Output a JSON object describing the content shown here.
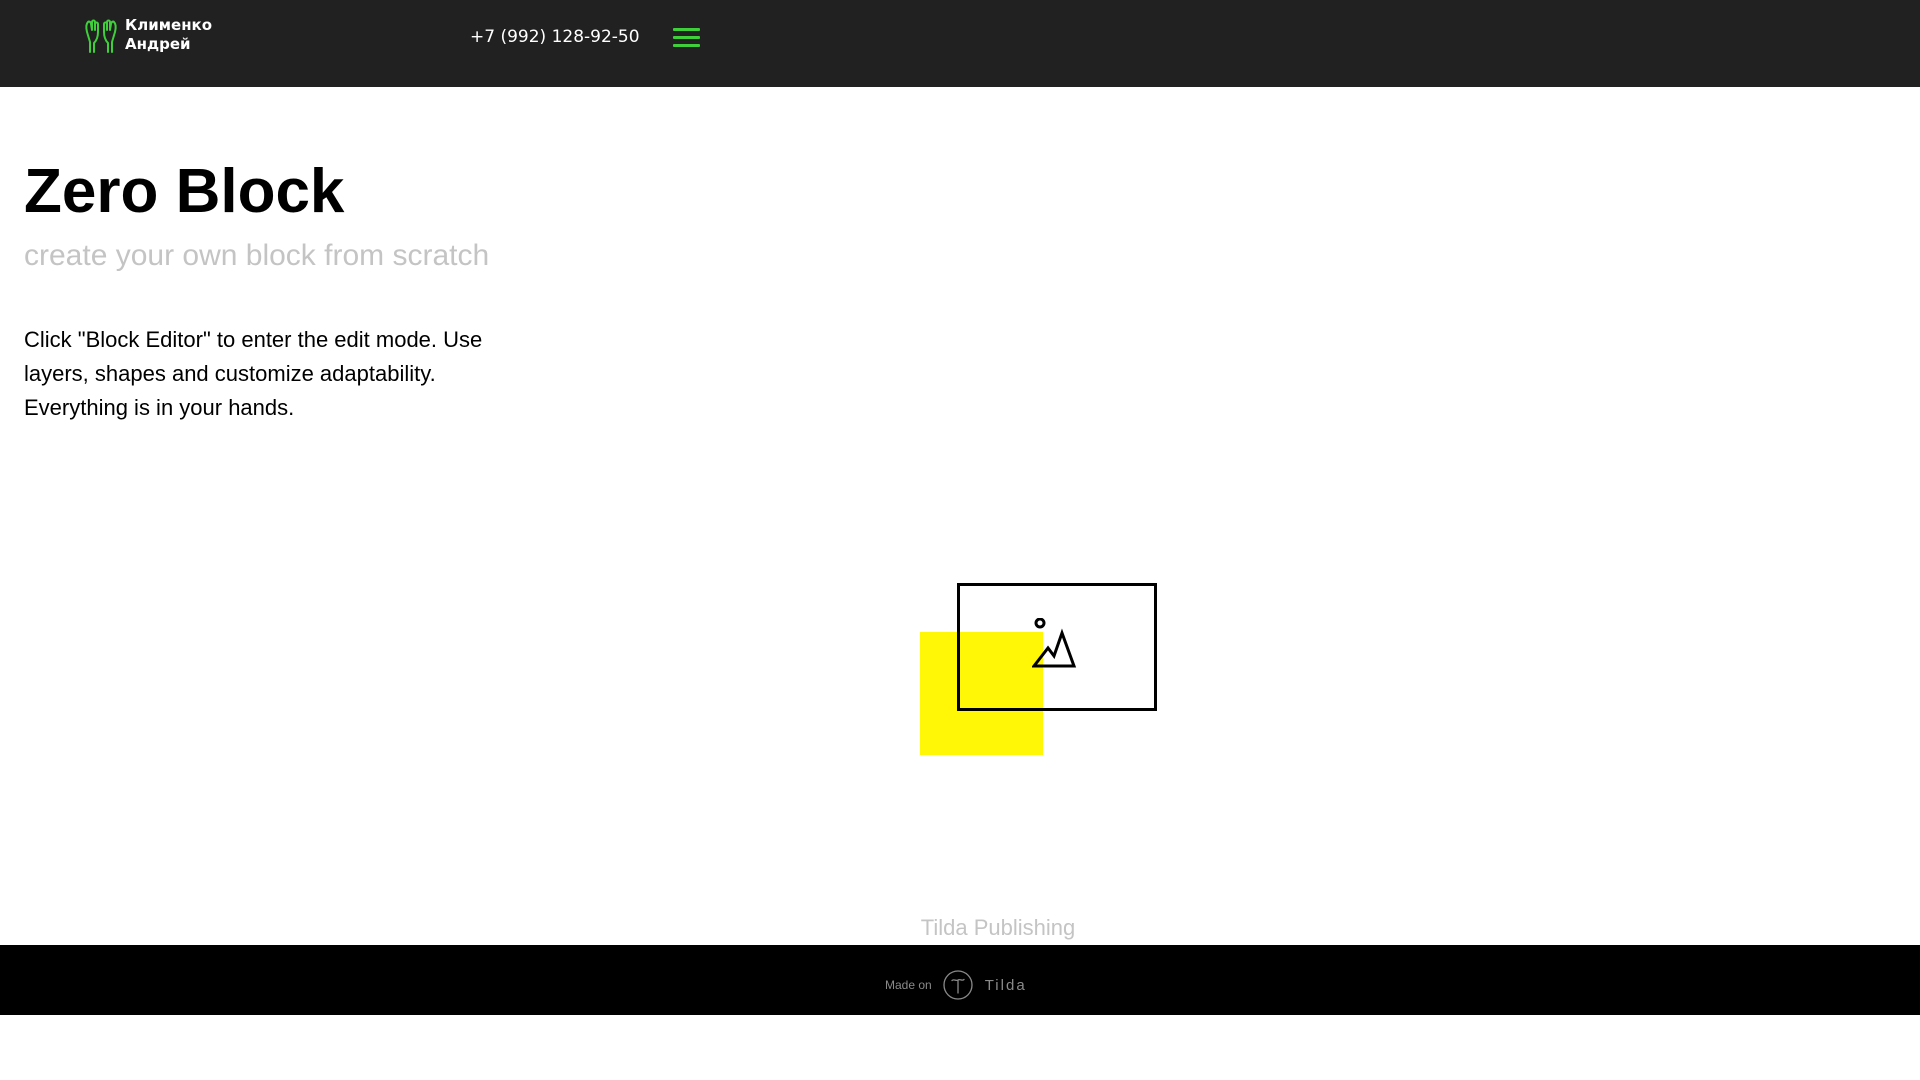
{
  "header": {
    "logo_line1": "Клименко",
    "logo_line2": "Андрей",
    "logo_icon": "gloves-icon",
    "phone": "+7 (992) 128-92-50",
    "menu_icon": "hamburger-menu-icon",
    "background": "#212121",
    "accent": "#3ecf3a"
  },
  "main": {
    "title": "Zero Block",
    "subtitle": "create your own block from scratch",
    "body": "Click \"Block Editor\" to enter the edit mode. Use layers, shapes and customize adaptability. Everything is in your hands.",
    "illustration_icon": "image-placeholder-icon",
    "accent_yellow": "#fff705"
  },
  "publisher_label": "Tilda Publishing",
  "footer": {
    "made_on": "Made on",
    "brand": "Tilda",
    "brand_icon": "tilda-logo-icon",
    "background": "#000000"
  }
}
